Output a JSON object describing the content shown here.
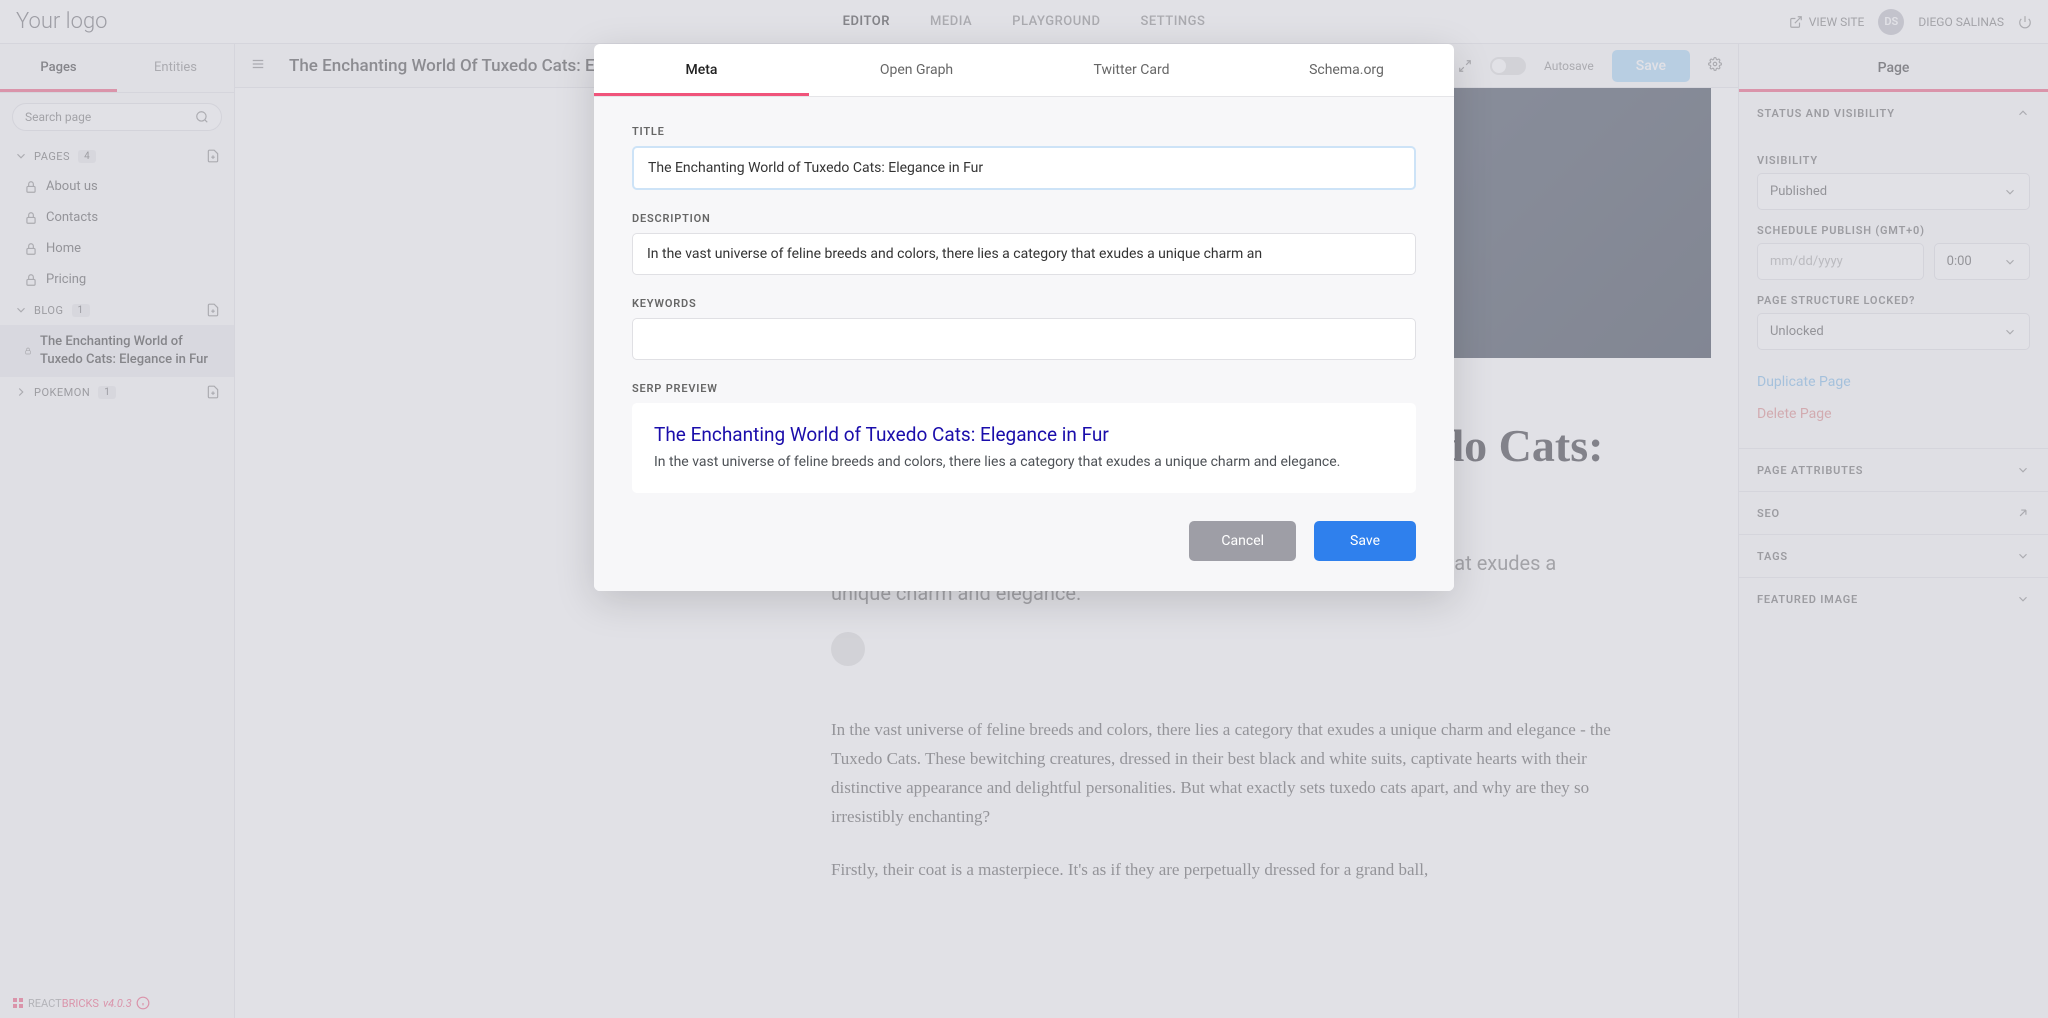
{
  "header": {
    "logo": "Your logo",
    "nav": [
      "EDITOR",
      "MEDIA",
      "PLAYGROUND",
      "SETTINGS"
    ],
    "view_site": "VIEW SITE",
    "user_initials": "DS",
    "user_name": "DIEGO SALINAS"
  },
  "sidebar": {
    "tabs": [
      "Pages",
      "Entities"
    ],
    "search_placeholder": "Search page",
    "sections": [
      {
        "label": "PAGES",
        "count": "4",
        "items": [
          "About us",
          "Contacts",
          "Home",
          "Pricing"
        ]
      },
      {
        "label": "BLOG",
        "count": "1",
        "selected": "The Enchanting World of Tuxedo Cats: Elegance in Fur"
      },
      {
        "label": "POKEMON",
        "count": "1"
      }
    ]
  },
  "toolbar": {
    "title": "The Enchanting World Of Tuxedo Cats: Elegance In Fur",
    "autosave": "Autosave",
    "save": "Save"
  },
  "article": {
    "h1": "The Enchanting World of Tuxedo Cats: Elegance in Fur",
    "lead": "In the vast universe of feline breeds and colors, there lies a category that exudes a unique charm and elegance.",
    "p1": "In the vast universe of feline breeds and colors, there lies a category that exudes a unique charm and elegance - the Tuxedo Cats. These bewitching creatures, dressed in their best black and white suits, captivate hearts with their distinctive appearance and delightful personalities. But what exactly sets tuxedo cats apart, and why are they so irresistibly enchanting?",
    "p2": "Firstly, their coat is a masterpiece. It's as if they are perpetually dressed for a grand ball,"
  },
  "rightpanel": {
    "tab": "Page",
    "status_head": "STATUS AND VISIBILITY",
    "visibility_label": "VISIBILITY",
    "visibility_value": "Published",
    "schedule_label": "SCHEDULE PUBLISH (GMT+0)",
    "date_placeholder": "mm/dd/yyyy",
    "time_value": "0:00",
    "lock_label": "PAGE STRUCTURE LOCKED?",
    "lock_value": "Unlocked",
    "duplicate": "Duplicate Page",
    "delete": "Delete Page",
    "collapsed": [
      "PAGE ATTRIBUTES",
      "SEO",
      "TAGS",
      "FEATURED IMAGE"
    ]
  },
  "modal": {
    "tabs": [
      "Meta",
      "Open Graph",
      "Twitter Card",
      "Schema.org"
    ],
    "title_label": "TITLE",
    "title_value": "The Enchanting World of Tuxedo Cats: Elegance in Fur",
    "desc_label": "DESCRIPTION",
    "desc_value": "In the vast universe of feline breeds and colors, there lies a category that exudes a unique charm an",
    "keywords_label": "KEYWORDS",
    "keywords_value": "",
    "serp_label": "SERP PREVIEW",
    "serp_title": "The Enchanting World of Tuxedo Cats: Elegance in Fur",
    "serp_desc": "In the vast universe of feline breeds and colors, there lies a category that exudes a unique charm and elegance.",
    "cancel": "Cancel",
    "save": "Save"
  },
  "footer": {
    "brand_a": "REACT",
    "brand_b": "BRICKS",
    "version": "v4.0.3"
  }
}
